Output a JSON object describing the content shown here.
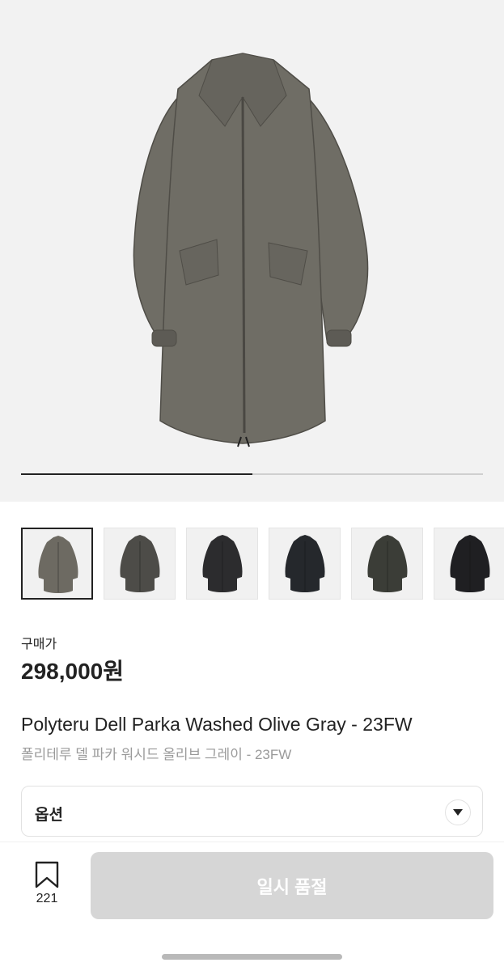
{
  "gallery": {
    "progress": 0.5,
    "thumbnails": [
      {
        "tone": "#6d6a62",
        "selected": true
      },
      {
        "tone": "#4d4c48",
        "selected": false
      },
      {
        "tone": "#2c2c2e",
        "selected": false
      },
      {
        "tone": "#25282c",
        "selected": false
      },
      {
        "tone": "#3b3d37",
        "selected": false
      },
      {
        "tone": "#1f1f22",
        "selected": false
      }
    ],
    "main_tone": "#6f6d65"
  },
  "product": {
    "price_label": "구매가",
    "price": "298,000원",
    "name_en": "Polyteru Dell Parka Washed Olive Gray - 23FW",
    "name_ko": "폴리테루 델 파카 워시드 올리브 그레이 - 23FW"
  },
  "option": {
    "label": "옵션",
    "icon": "chevron-down-icon"
  },
  "bottom": {
    "bookmark_icon": "bookmark-icon",
    "bookmark_count": "221",
    "soldout_label": "일시 품절"
  }
}
